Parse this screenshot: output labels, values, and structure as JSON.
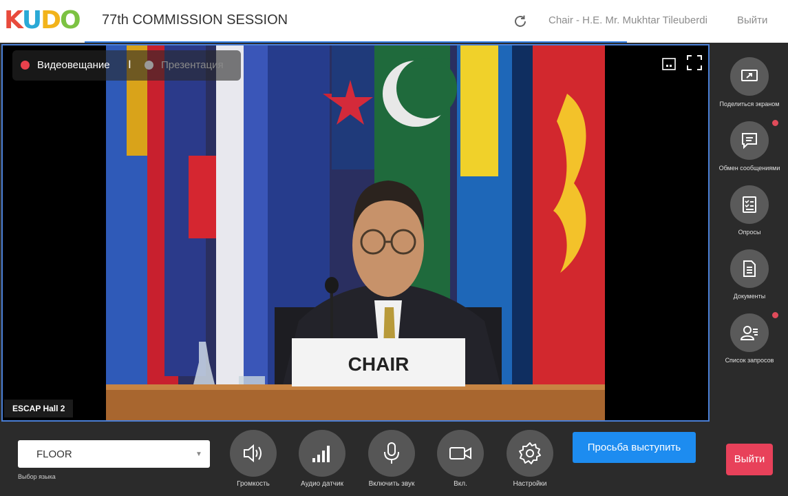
{
  "header": {
    "logo": [
      "K",
      "U",
      "D",
      "O"
    ],
    "session_title": "77th COMMISSION SESSION",
    "user": "Chair - H.E. Mr. Mukhtar Tileuberdi",
    "exit_label": "Выйти"
  },
  "video": {
    "mode_live": "Видеовещание",
    "mode_separator": "I",
    "mode_presentation": "Презентация",
    "hall_label": "ESCAP Hall 2",
    "nameplate": "CHAIR"
  },
  "sidebar": {
    "items": [
      {
        "label": "Поделиться экраном",
        "icon": "share-screen-icon",
        "notification": false
      },
      {
        "label": "Обмен сообщениями",
        "icon": "chat-icon",
        "notification": true
      },
      {
        "label": "Опросы",
        "icon": "polls-icon",
        "notification": false
      },
      {
        "label": "Документы",
        "icon": "documents-icon",
        "notification": false
      },
      {
        "label": "Список запросов",
        "icon": "request-list-icon",
        "notification": true
      }
    ]
  },
  "bottom": {
    "language_value": "FLOOR",
    "language_label": "Выбор языка",
    "controls": [
      {
        "label": "Громкость",
        "icon": "volume-icon"
      },
      {
        "label": "Аудио датчик",
        "icon": "audio-meter-icon"
      },
      {
        "label": "Включить звук",
        "icon": "microphone-icon"
      },
      {
        "label": "Вкл.",
        "icon": "camera-icon"
      },
      {
        "label": "Настройки",
        "icon": "settings-icon"
      }
    ],
    "request_button": "Просьба выступить",
    "exit_button": "Выйти"
  },
  "colors": {
    "accent": "#1d8cf0",
    "exit": "#e8415a",
    "live_dot": "#e8414c",
    "notification_dot": "#e04b5a",
    "logo": [
      "#e84a3c",
      "#2aa9d6",
      "#f2b31a",
      "#7cc242"
    ]
  }
}
